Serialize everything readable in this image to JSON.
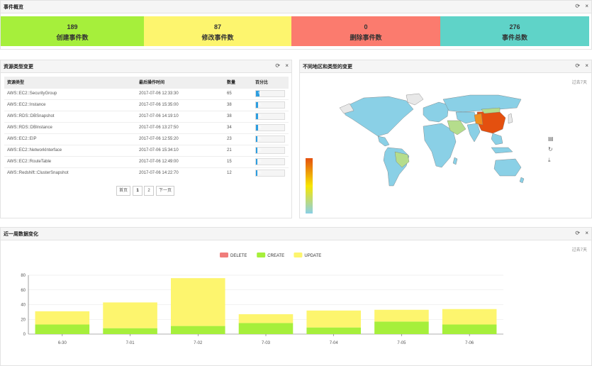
{
  "overview": {
    "title": "事件概览",
    "stats": [
      {
        "value": "189",
        "label": "创建事件数",
        "color": "#a6ef3b"
      },
      {
        "value": "87",
        "label": "修改事件数",
        "color": "#fdf56e"
      },
      {
        "value": "0",
        "label": "删除事件数",
        "color": "#fb7b6e"
      },
      {
        "value": "276",
        "label": "事件总数",
        "color": "#5fd3c8"
      }
    ]
  },
  "tools": {
    "refresh": "⟳",
    "close": "×"
  },
  "resource": {
    "title": "资源类型变更",
    "columns": [
      "资源类型",
      "最后操作时间",
      "数量",
      "百分比"
    ],
    "rows": [
      {
        "type": "AWS::EC2::SecurityGroup",
        "time": "2017-07-06 12:33:30",
        "count": "65",
        "pct": 0.24
      },
      {
        "type": "AWS::EC2::Instance",
        "time": "2017-07-06 15:35:00",
        "count": "38",
        "pct": 0.14
      },
      {
        "type": "AWS::RDS::DBSnapshot",
        "time": "2017-07-06 14:19:10",
        "count": "38",
        "pct": 0.14
      },
      {
        "type": "AWS::RDS::DBInstance",
        "time": "2017-07-06 13:27:50",
        "count": "34",
        "pct": 0.12
      },
      {
        "type": "AWS::EC2::EIP",
        "time": "2017-07-06 12:55:20",
        "count": "23",
        "pct": 0.08
      },
      {
        "type": "AWS::EC2::NetworkInterface",
        "time": "2017-07-06 15:34:10",
        "count": "21",
        "pct": 0.08
      },
      {
        "type": "AWS::EC2::RouteTable",
        "time": "2017-07-06 12:49:00",
        "count": "15",
        "pct": 0.05
      },
      {
        "type": "AWS::Redshift::ClusterSnapshot",
        "time": "2017-07-06 14:22:70",
        "count": "12",
        "pct": 0.04
      }
    ],
    "pct_text": "%",
    "pager": {
      "first": "首页",
      "p1": "1",
      "p2": "2",
      "next": "下一页"
    }
  },
  "map": {
    "title": "不同地区和类型的变更",
    "range": "过去7天",
    "icons": [
      "data-view-icon",
      "restore-icon",
      "download-icon"
    ],
    "legend_colors": [
      "#e4500f",
      "#f7e600",
      "#8ad0e6"
    ]
  },
  "weekly": {
    "title": "近一周数据变化",
    "range": "过去7天"
  },
  "chart_data": {
    "type": "bar",
    "stacked": true,
    "categories": [
      "6-30",
      "7-01",
      "7-02",
      "7-03",
      "7-04",
      "7-05",
      "7-06"
    ],
    "series": [
      {
        "name": "DELETE",
        "color": "#f07d7b",
        "values": [
          0,
          0,
          0,
          0,
          0,
          0,
          0
        ]
      },
      {
        "name": "CREATE",
        "color": "#a6ef3b",
        "values": [
          13,
          8,
          11,
          15,
          9,
          17,
          13
        ]
      },
      {
        "name": "UPDATE",
        "color": "#fdf56e",
        "values": [
          18,
          35,
          65,
          12,
          23,
          16,
          21
        ]
      }
    ],
    "ylim": [
      0,
      80
    ],
    "yticks": [
      0,
      20,
      40,
      60,
      80
    ],
    "legend_position": "top-center",
    "grid": true
  }
}
